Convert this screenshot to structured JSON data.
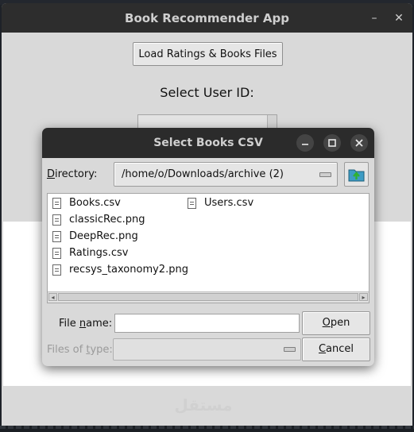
{
  "app": {
    "title": "Book Recommender App",
    "minimize_glyph": "–",
    "close_glyph": "✕",
    "load_button": "Load Ratings & Books Files",
    "select_user_label": "Select User ID:",
    "selected_user": ""
  },
  "dialog": {
    "title": "Select Books CSV",
    "directory_label_mnemonic": "D",
    "directory_label_rest": "irectory:",
    "directory_path": "/home/o/Downloads/archive (2)",
    "up_icon": "folder-up-icon",
    "files": [
      {
        "name": "Books.csv",
        "icon": "file-icon"
      },
      {
        "name": "classicRec.png",
        "icon": "file-icon"
      },
      {
        "name": "DeepRec.png",
        "icon": "file-icon"
      },
      {
        "name": "Ratings.csv",
        "icon": "file-icon"
      },
      {
        "name": "recsys_taxonomy2.png",
        "icon": "file-icon"
      },
      {
        "name": "Users.csv",
        "icon": "file-icon"
      }
    ],
    "file_name_label_pre": "File ",
    "file_name_label_mnemonic": "n",
    "file_name_label_post": "ame:",
    "file_name_value": "",
    "file_type_label_pre": "Files of ",
    "file_type_label_mnemonic": "t",
    "file_type_label_post": "ype:",
    "file_type_value": "",
    "open_button_mnemonic": "O",
    "open_button_rest": "pen",
    "cancel_button_mnemonic": "C",
    "cancel_button_rest": "ancel"
  },
  "watermark": "مستقل",
  "colors": {
    "titlebar": "#2d2d2d",
    "window_bg": "#d9d9d9",
    "list_bg": "#ffffff"
  }
}
